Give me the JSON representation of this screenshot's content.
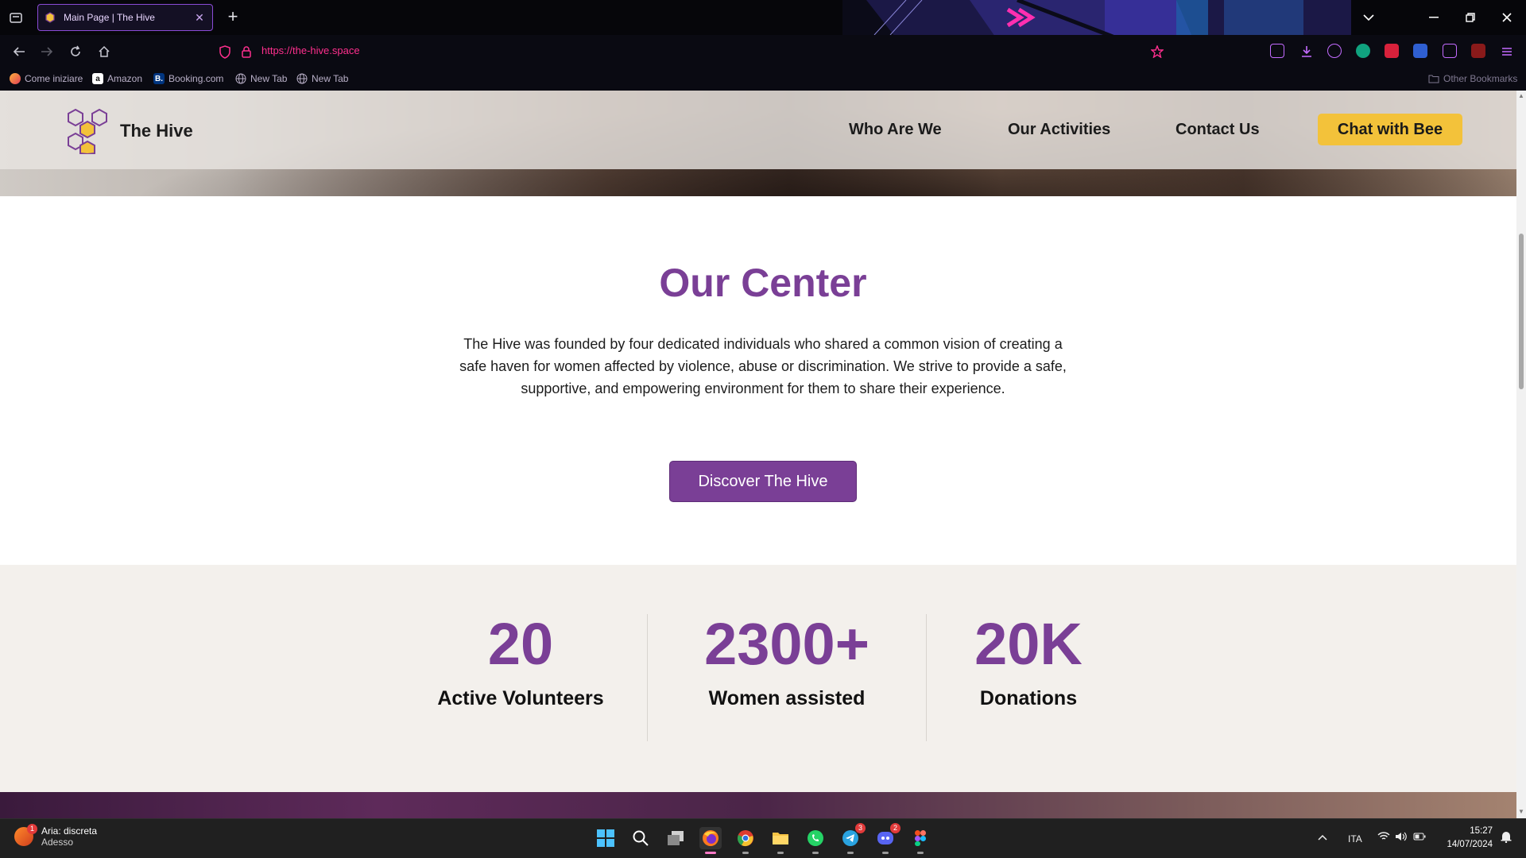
{
  "browser": {
    "tab_title": "Main Page | The Hive",
    "url": "https://the-hive.space",
    "bookmarks": [
      {
        "label": "Come iniziare",
        "icon": "firefox-icon"
      },
      {
        "label": "Amazon",
        "icon": "amazon-icon"
      },
      {
        "label": "Booking.com",
        "icon": "booking-icon"
      },
      {
        "label": "New Tab",
        "icon": "globe-icon"
      },
      {
        "label": "New Tab",
        "icon": "globe-icon"
      }
    ],
    "other_bookmarks": "Other Bookmarks",
    "accent_color": "#ff2f8e",
    "tab_border_color": "#8a4bd6"
  },
  "site": {
    "logo_text": "The Hive",
    "nav": [
      "Who Are We",
      "Our Activities",
      "Contact Us"
    ],
    "cta": "Chat with Bee",
    "cta_color": "#f3c23a",
    "brand_color": "#7a3f96"
  },
  "center": {
    "title": "Our Center",
    "description": "The Hive was founded by four dedicated individuals who shared a common vision of creating a safe haven for women affected by violence, abuse or discrimination. We strive to provide a safe, supportive, and empowering environment for them to share their experience.",
    "button": "Discover The Hive"
  },
  "stats": [
    {
      "value": "20",
      "label": "Active Volunteers"
    },
    {
      "value": "2300+",
      "label": "Women assisted"
    },
    {
      "value": "20K",
      "label": "Donations"
    }
  ],
  "taskbar": {
    "weather_title": "Aria: discreta",
    "weather_sub": "Adesso",
    "weather_badge": "1",
    "telegram_badge": "3",
    "discord_badge": "2",
    "language": "ITA",
    "time": "15:27",
    "date": "14/07/2024"
  }
}
